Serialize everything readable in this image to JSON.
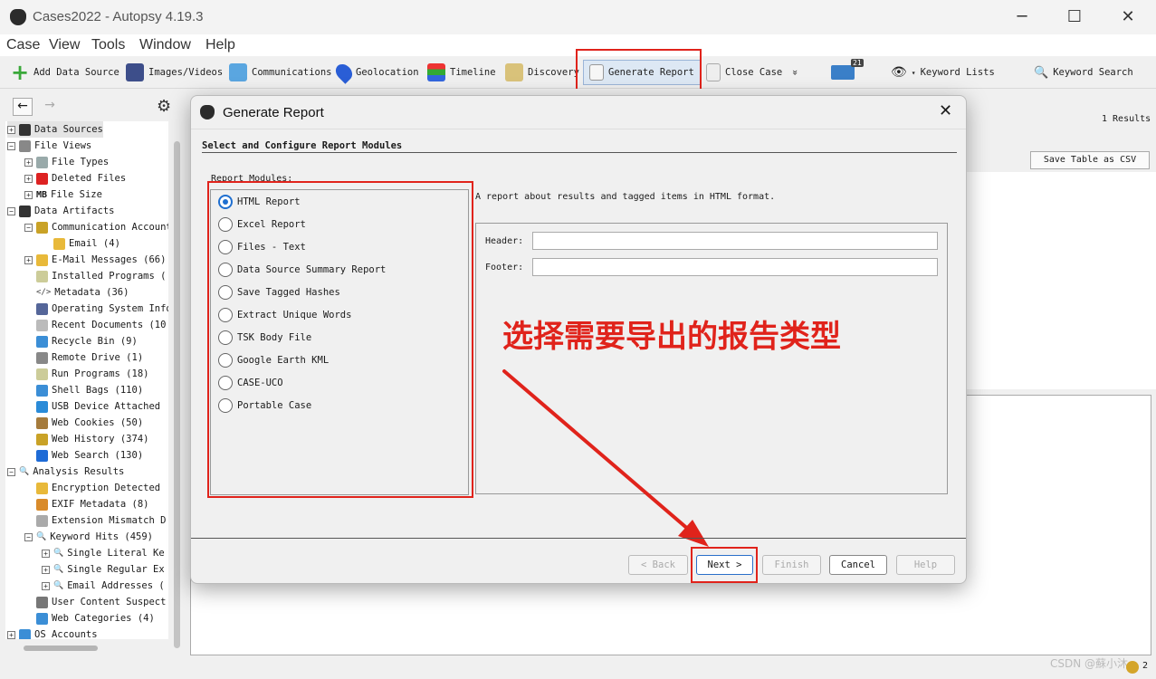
{
  "window": {
    "title": "Cases2022 - Autopsy 4.19.3",
    "minimize": "─",
    "maximize": "☐",
    "close": "✕"
  },
  "menu": [
    "Case",
    "View",
    "Tools",
    "Window",
    "Help"
  ],
  "toolbar": {
    "add_data_source": "Add Data Source",
    "images_videos": "Images/Videos",
    "communications": "Communications",
    "geolocation": "Geolocation",
    "timeline": "Timeline",
    "discovery": "Discovery",
    "generate_report": "Generate Report",
    "close_case": "Close Case",
    "close_case_chevron": "»",
    "email_badge": "21",
    "keyword_lists": "Keyword Lists",
    "keyword_search": "Keyword Search"
  },
  "tree": [
    {
      "label": "Data Sources",
      "level": 0,
      "exp": "+",
      "color": "#333"
    },
    {
      "label": "File Views",
      "level": 0,
      "exp": "−",
      "color": "#888"
    },
    {
      "label": "File Types",
      "level": 1,
      "exp": "+",
      "color": "#9aa"
    },
    {
      "label": "Deleted Files",
      "level": 1,
      "exp": "+",
      "color": "#d22"
    },
    {
      "label": "File Size",
      "level": 1,
      "exp": "+",
      "prefix": "MB"
    },
    {
      "label": "Data Artifacts",
      "level": 0,
      "exp": "−",
      "color": "#333"
    },
    {
      "label": "Communication Accounts",
      "level": 1,
      "exp": "−",
      "color": "#c9a227"
    },
    {
      "label": "Email (4)",
      "level": 2,
      "exp": "",
      "color": "#e8b93a"
    },
    {
      "label": "E-Mail Messages (66)",
      "level": 1,
      "exp": "+",
      "color": "#e8b93a"
    },
    {
      "label": "Installed Programs (",
      "level": 1,
      "exp": "",
      "color": "#cc9"
    },
    {
      "label": "Metadata (36)",
      "level": 1,
      "exp": "",
      "glyph": "</>"
    },
    {
      "label": "Operating System Info",
      "level": 1,
      "exp": "",
      "color": "#569"
    },
    {
      "label": "Recent Documents (10",
      "level": 1,
      "exp": "",
      "color": "#bbb"
    },
    {
      "label": "Recycle Bin (9)",
      "level": 1,
      "exp": "",
      "color": "#3b8ed6"
    },
    {
      "label": "Remote Drive (1)",
      "level": 1,
      "exp": "",
      "color": "#888"
    },
    {
      "label": "Run Programs (18)",
      "level": 1,
      "exp": "",
      "color": "#cc9"
    },
    {
      "label": "Shell Bags (110)",
      "level": 1,
      "exp": "",
      "color": "#3b8ed6"
    },
    {
      "label": "USB Device Attached",
      "level": 1,
      "exp": "",
      "color": "#2a8bd8"
    },
    {
      "label": "Web Cookies (50)",
      "level": 1,
      "exp": "",
      "color": "#a57b3c"
    },
    {
      "label": "Web History (374)",
      "level": 1,
      "exp": "",
      "color": "#c9a227"
    },
    {
      "label": "Web Search (130)",
      "level": 1,
      "exp": "",
      "color": "#1e6bd6"
    },
    {
      "label": "Analysis Results",
      "level": 0,
      "exp": "−",
      "glyph": "🔍"
    },
    {
      "label": "Encryption Detected",
      "level": 1,
      "exp": "",
      "color": "#e8b93a"
    },
    {
      "label": "EXIF Metadata (8)",
      "level": 1,
      "exp": "",
      "color": "#d98b2b"
    },
    {
      "label": "Extension Mismatch D",
      "level": 1,
      "exp": "",
      "color": "#aaa"
    },
    {
      "label": "Keyword Hits (459)",
      "level": 1,
      "exp": "−",
      "glyph": "🔍"
    },
    {
      "label": "Single Literal Ke",
      "level": 2,
      "exp": "+",
      "glyph": "🔍"
    },
    {
      "label": "Single Regular Ex",
      "level": 2,
      "exp": "+",
      "glyph": "🔍"
    },
    {
      "label": "Email Addresses (",
      "level": 2,
      "exp": "+",
      "glyph": "🔍"
    },
    {
      "label": "User Content Suspect",
      "level": 1,
      "exp": "",
      "color": "#777"
    },
    {
      "label": "Web Categories (4)",
      "level": 1,
      "exp": "",
      "color": "#3b8ed6"
    },
    {
      "label": "OS Accounts",
      "level": 0,
      "exp": "+",
      "color": "#3b8ed6"
    }
  ],
  "right_panel": {
    "results": "1 Results",
    "save_csv": "Save Table as CSV"
  },
  "dialog": {
    "title": "Generate Report",
    "section_title": "Select and Configure Report Modules",
    "modules_label": "Report Modules:",
    "modules": [
      "HTML Report",
      "Excel Report",
      "Files - Text",
      "Data Source Summary Report",
      "Save Tagged Hashes",
      "Extract Unique Words",
      "TSK Body File",
      "Google Earth KML",
      "CASE-UCO",
      "Portable Case"
    ],
    "selected_module": "HTML Report",
    "description": "A report about results and tagged items in HTML format.",
    "header_label": "Header:",
    "footer_label": "Footer:",
    "header_value": "",
    "footer_value": "",
    "buttons": {
      "back": "< Back",
      "next": "Next >",
      "finish": "Finish",
      "cancel": "Cancel",
      "help": "Help"
    }
  },
  "annotation": {
    "text": "选择需要导出的报告类型",
    "color": "#e0231b"
  },
  "watermark": "CSDN @蘇小沐",
  "tray_count": "2"
}
